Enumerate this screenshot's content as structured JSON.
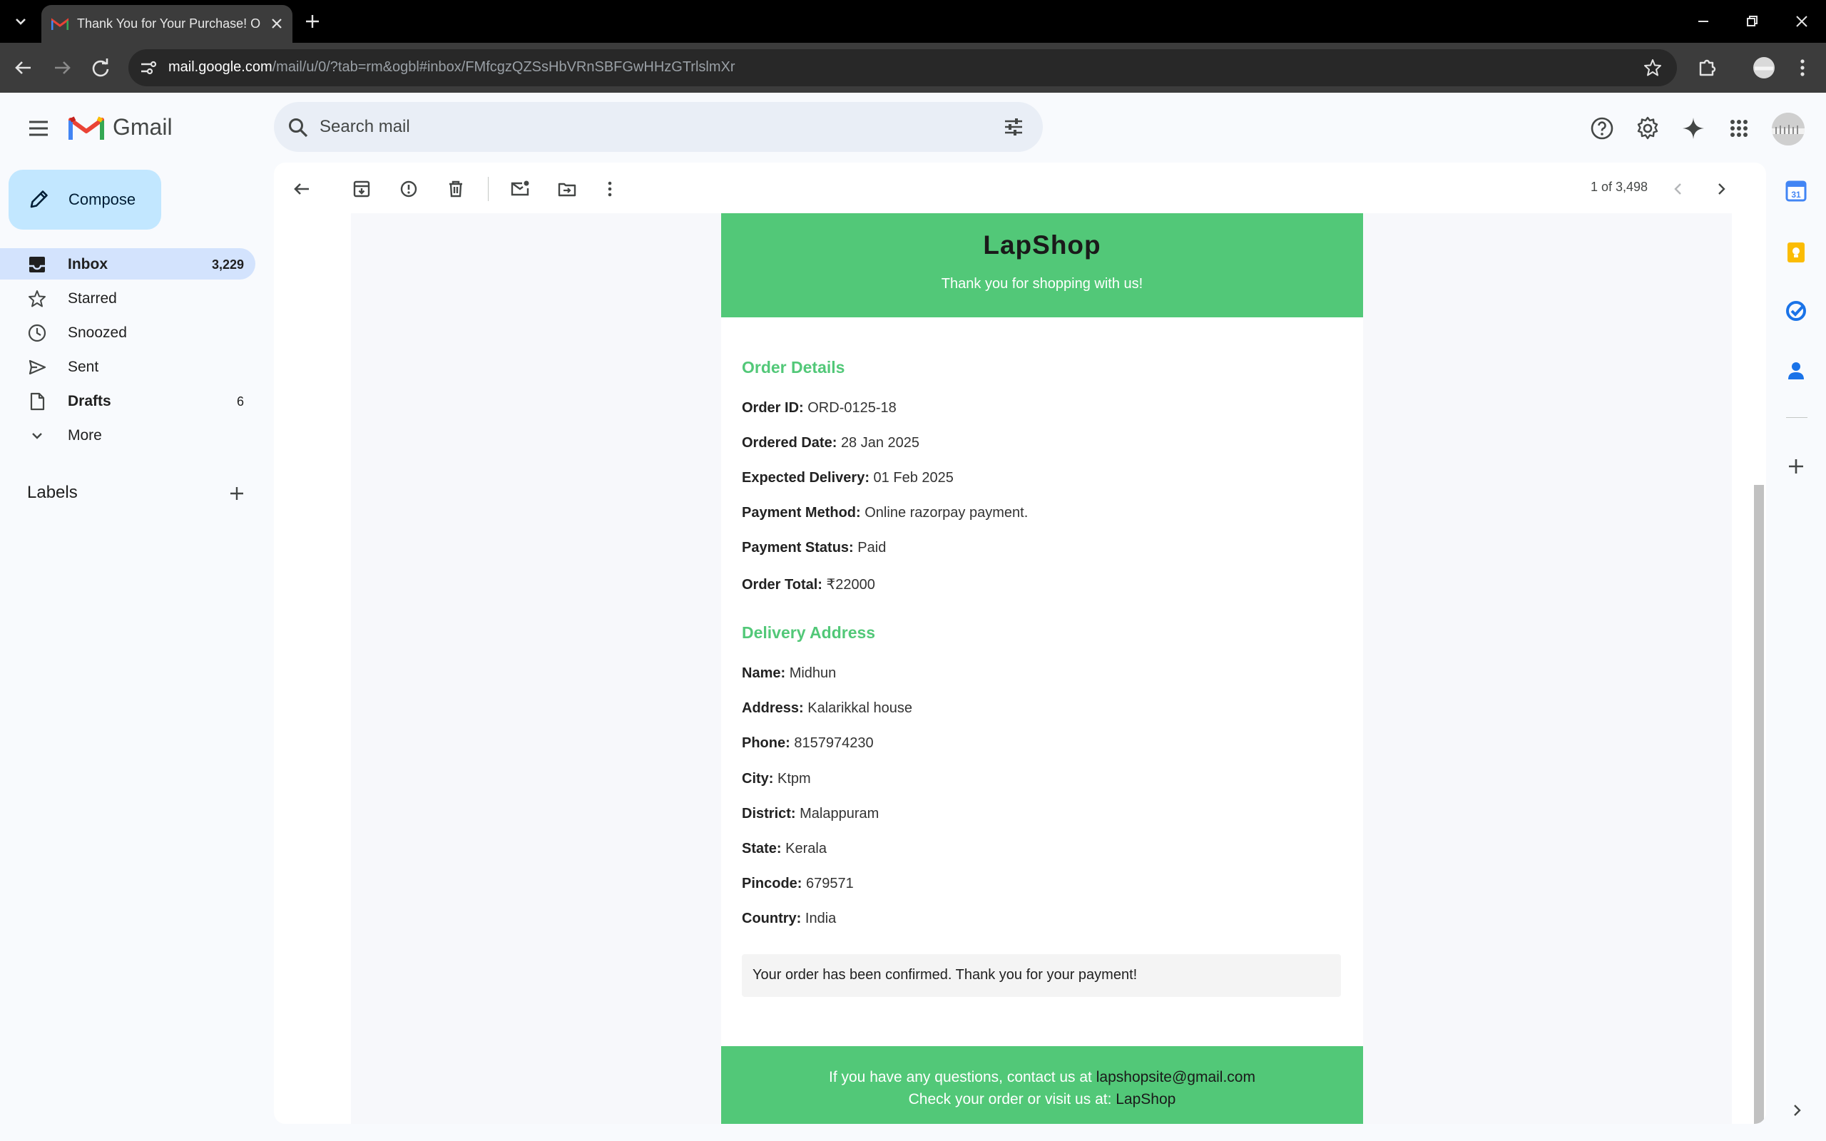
{
  "browser": {
    "tab_title": "Thank You for Your Purchase! O",
    "url_host": "mail.google.com",
    "url_path": "/mail/u/0/?tab=rm&ogbl#inbox/FMfcgzQZSsHbVRnSBFGwHHzGTrlslmXr"
  },
  "gmail": {
    "wordmark": "Gmail",
    "search_placeholder": "Search mail",
    "compose_label": "Compose",
    "nav": [
      {
        "label": "Inbox",
        "count": "3,229",
        "icon": "inbox-icon"
      },
      {
        "label": "Starred",
        "count": "",
        "icon": "star-icon"
      },
      {
        "label": "Snoozed",
        "count": "",
        "icon": "clock-icon"
      },
      {
        "label": "Sent",
        "count": "",
        "icon": "send-icon"
      },
      {
        "label": "Drafts",
        "count": "6",
        "icon": "draft-icon"
      },
      {
        "label": "More",
        "count": "",
        "icon": "chevron-down-icon"
      }
    ],
    "labels_title": "Labels",
    "pager": "1 of 3,498"
  },
  "email": {
    "brand": "LapShop",
    "tagline": "Thank you for shopping with us!",
    "order_details_title": "Order Details",
    "order_details": [
      {
        "label": "Order ID:",
        "value": "ORD-0125-18"
      },
      {
        "label": "Ordered Date:",
        "value": "28 Jan 2025"
      },
      {
        "label": "Expected Delivery:",
        "value": "01 Feb 2025"
      },
      {
        "label": "Payment Method:",
        "value": "Online razorpay payment."
      },
      {
        "label": "Payment Status:",
        "value": "Paid"
      },
      {
        "label": "Order Total:",
        "value": "₹22000"
      }
    ],
    "delivery_title": "Delivery Address",
    "delivery": [
      {
        "label": "Name:",
        "value": "Midhun"
      },
      {
        "label": "Address:",
        "value": "Kalarikkal house"
      },
      {
        "label": "Phone:",
        "value": "8157974230"
      },
      {
        "label": "City:",
        "value": "Ktpm"
      },
      {
        "label": "District:",
        "value": "Malappuram"
      },
      {
        "label": "State:",
        "value": "Kerala"
      },
      {
        "label": "Pincode:",
        "value": "679571"
      },
      {
        "label": "Country:",
        "value": "India"
      }
    ],
    "confirmation": "Your order has been confirmed. Thank you for your payment!",
    "footer_line1_text": "If you have any questions, contact us at ",
    "footer_email": "lapshopsite@gmail.com",
    "footer_line2_text": "Check your order or visit us at: ",
    "footer_site": "LapShop"
  },
  "colors": {
    "brand_green": "#52c878",
    "compose_bg": "#c2e7ff",
    "active_nav_bg": "#d3e3fd",
    "search_bg": "#e9eef6"
  }
}
